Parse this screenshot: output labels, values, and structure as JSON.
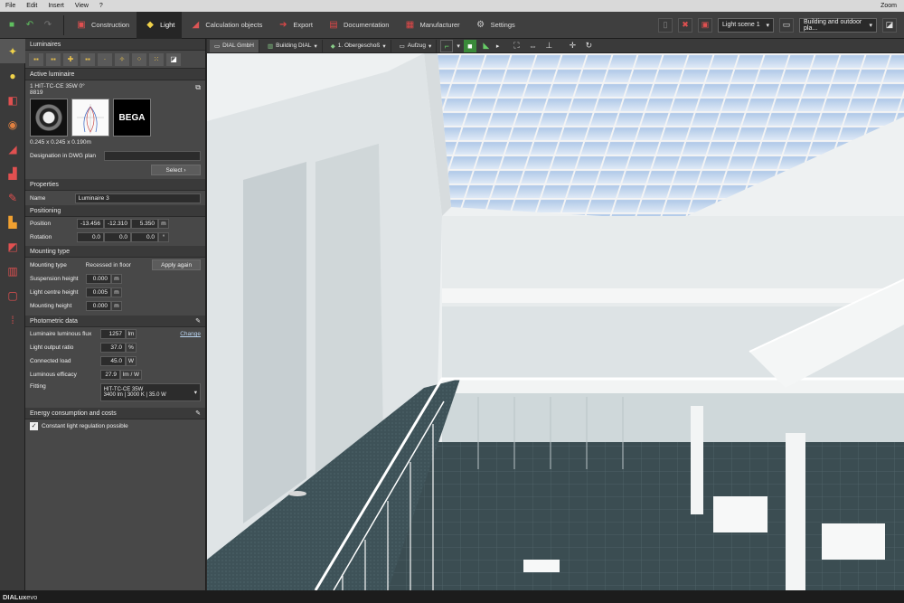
{
  "menu": {
    "file": "File",
    "edit": "Edit",
    "insert": "Insert",
    "view": "View",
    "help": "?",
    "zoom": "Zoom"
  },
  "tabs": {
    "construction": "Construction",
    "light": "Light",
    "calc": "Calculation objects",
    "export": "Export",
    "documentation": "Documentation",
    "manufacturer": "Manufacturer",
    "settings": "Settings"
  },
  "toolbar_right": {
    "light_scene": "Light scene 1",
    "view_mode": "Building and outdoor pla..."
  },
  "panel": {
    "luminaires_title": "Luminaires",
    "active_title": "Active luminaire",
    "lum_name": "1 HIT-TC-CE 35W 0°",
    "lum_number": "8819",
    "brand": "BEGA",
    "dims": "0.245 x 0.245 x 0.190m",
    "designation_label": "Designation in DWG plan",
    "select_label": "Select",
    "properties_title": "Properties",
    "name_label": "Name",
    "name_value": "Luminaire 3",
    "positioning_title": "Positioning",
    "position_label": "Position",
    "pos_x": "-13.456",
    "pos_y": "-12.310",
    "pos_z": "5.350",
    "pos_unit": "m",
    "rotation_label": "Rotation",
    "rot_x": "0.0",
    "rot_y": "0.0",
    "rot_z": "0.0",
    "rot_unit": "°",
    "mounting_title": "Mounting type",
    "mounting_type_label": "Mounting type",
    "mounting_type_value": "Recessed in floor",
    "apply_again": "Apply again",
    "susp_label": "Suspension height",
    "susp_value": "0.000",
    "susp_unit": "m",
    "lcentre_label": "Light centre height",
    "lcentre_value": "0.005",
    "lcentre_unit": "m",
    "mheight_label": "Mounting height",
    "mheight_value": "0.000",
    "mheight_unit": "m",
    "photometric_title": "Photometric data",
    "flux_label": "Luminaire luminous flux",
    "flux_value": "1257",
    "flux_unit": "lm",
    "change": "Change",
    "lor_label": "Light output ratio",
    "lor_value": "37.0",
    "lor_unit": "%",
    "load_label": "Connected load",
    "load_value": "45.0",
    "load_unit": "W",
    "efficacy_label": "Luminous efficacy",
    "efficacy_value": "27.9",
    "efficacy_unit": "lm / W",
    "fitting_label": "Fitting",
    "fitting_line1": "HIT-TC-CE  35W",
    "fitting_line2": "3400 lm  |  3000 K  |  35.0 W",
    "energy_title": "Energy consumption and costs",
    "constant_label": "Constant light regulation possible"
  },
  "viewbar": {
    "company": "DIAL GmbH",
    "building": "Building DIAL",
    "floor": "1. Obergeschoß",
    "elevator": "Aufzug"
  },
  "status": {
    "brand_bold": "DIALux",
    "brand_rest": " evo"
  }
}
